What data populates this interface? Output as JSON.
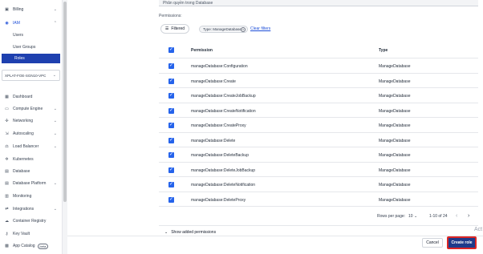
{
  "sidebar": {
    "top_items": [
      {
        "label": "Billing",
        "icon": "billing-icon"
      },
      {
        "label": "IAM",
        "icon": "iam-icon"
      }
    ],
    "iam_sub": [
      {
        "label": "Users"
      },
      {
        "label": "User Groups"
      },
      {
        "label": "Roles",
        "active": true
      }
    ],
    "project": "XPLAT-FOE-SGN10-VPC",
    "items": [
      {
        "label": "Dashboard",
        "icon": "dashboard-icon",
        "chevron": false
      },
      {
        "label": "Compute Engine",
        "icon": "compute-icon",
        "chevron": true
      },
      {
        "label": "Networking",
        "icon": "network-icon",
        "chevron": true
      },
      {
        "label": "Autoscaling",
        "icon": "autoscaling-icon",
        "chevron": true
      },
      {
        "label": "Load Balancer",
        "icon": "load-balancer-icon",
        "chevron": true
      },
      {
        "label": "Kubernetes",
        "icon": "kubernetes-icon",
        "chevron": false
      },
      {
        "label": "Database",
        "icon": "database-icon",
        "chevron": false
      },
      {
        "label": "Database Platform",
        "icon": "database-platform-icon",
        "chevron": true
      },
      {
        "label": "Monitoring",
        "icon": "monitoring-icon",
        "chevron": false
      },
      {
        "label": "Integrations",
        "icon": "integrations-icon",
        "chevron": true
      },
      {
        "label": "Container Registry",
        "icon": "container-icon",
        "chevron": false
      },
      {
        "label": "Key Vault",
        "icon": "key-icon",
        "chevron": false
      },
      {
        "label": "App Catalog",
        "icon": "app-catalog-icon",
        "chevron": false,
        "badge": "beta"
      }
    ]
  },
  "form": {
    "description_value": "Phân quyền trong Database",
    "permissions_label": "Permissions:",
    "filter_button": "Filtered",
    "filter_chip": "Type: ManageDatabase",
    "clear_filters": "Clear filters"
  },
  "table": {
    "headers": {
      "permission": "Permission",
      "type": "Type"
    },
    "rows": [
      {
        "permission": "manageDatabase:Configuration",
        "type": "ManageDatabase"
      },
      {
        "permission": "manageDatabase:Create",
        "type": "ManageDatabase"
      },
      {
        "permission": "manageDatabase:CreateJobBackup",
        "type": "ManageDatabase"
      },
      {
        "permission": "manageDatabase:CreateNotification",
        "type": "ManageDatabase"
      },
      {
        "permission": "manageDatabase:CreateProxy",
        "type": "ManageDatabase"
      },
      {
        "permission": "manageDatabase:Delete",
        "type": "ManageDatabase"
      },
      {
        "permission": "manageDatabase:DeleteBackup",
        "type": "ManageDatabase"
      },
      {
        "permission": "manageDatabase:DeleteJobBackup",
        "type": "ManageDatabase"
      },
      {
        "permission": "manageDatabase:DeleteNotification",
        "type": "ManageDatabase"
      },
      {
        "permission": "manageDatabase:DeleteProxy",
        "type": "ManageDatabase"
      }
    ]
  },
  "pager": {
    "rows_per_page_label": "Rows per page:",
    "rows_per_page_value": "10",
    "range": "1-10 of 24"
  },
  "show_added": "Show added permissions",
  "actions": {
    "cancel": "Cancel",
    "create": "Create role"
  },
  "watermark": "Act",
  "colors": {
    "accent": "#1e40af",
    "checkbox": "#2563eb",
    "create_border": "#dc2626"
  }
}
